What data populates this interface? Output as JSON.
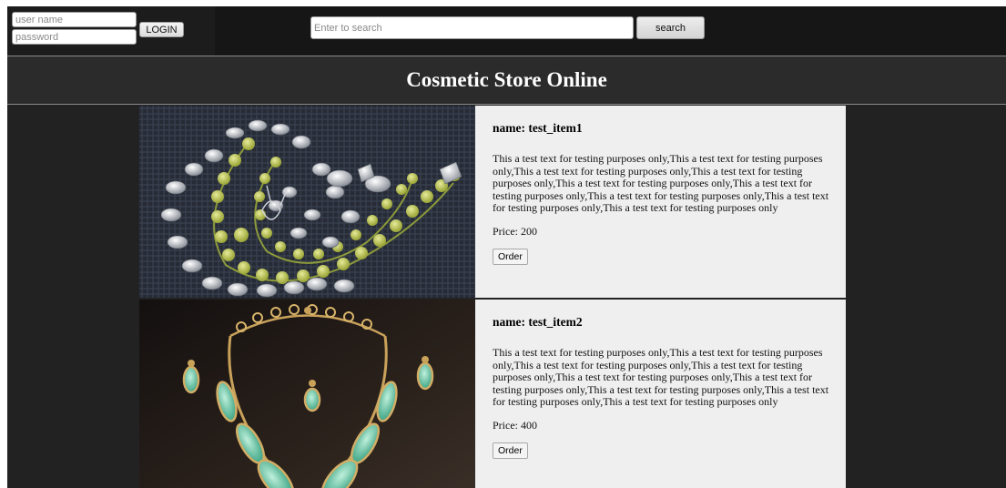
{
  "login": {
    "username_placeholder": "user name",
    "password_placeholder": "password",
    "login_label": "LOGIN"
  },
  "search": {
    "placeholder": "Enter to search",
    "button_label": "search"
  },
  "site_title": "Cosmetic Store Online",
  "products": [
    {
      "name": "name: test_item1",
      "description": "This a test text for testing purposes only,This a test text for testing purposes only,This a test text for testing purposes only,This a test text for testing purposes only,This a test text for testing purposes only,This a test text for testing purposes only,This a test text for testing purposes only,This a test text for testing purposes only,This a test text for testing purposes only",
      "price": "Price: 200",
      "order_label": "Order",
      "image": "yellow-bead-paisley-necklace-image"
    },
    {
      "name": "name: test_item2",
      "description": "This a test text for testing purposes only,This a test text for testing purposes only,This a test text for testing purposes only,This a test text for testing purposes only,This a test text for testing purposes only,This a test text for testing purposes only,This a test text for testing purposes only,This a test text for testing purposes only,This a test text for testing purposes only",
      "price": "Price: 400",
      "order_label": "Order",
      "image": "turquoise-necklace-earrings-image"
    }
  ],
  "colors": {
    "page_bg": "#222222",
    "topbar_bg": "#161616",
    "card_bg": "#efefef",
    "title_text": "#ffffff"
  }
}
